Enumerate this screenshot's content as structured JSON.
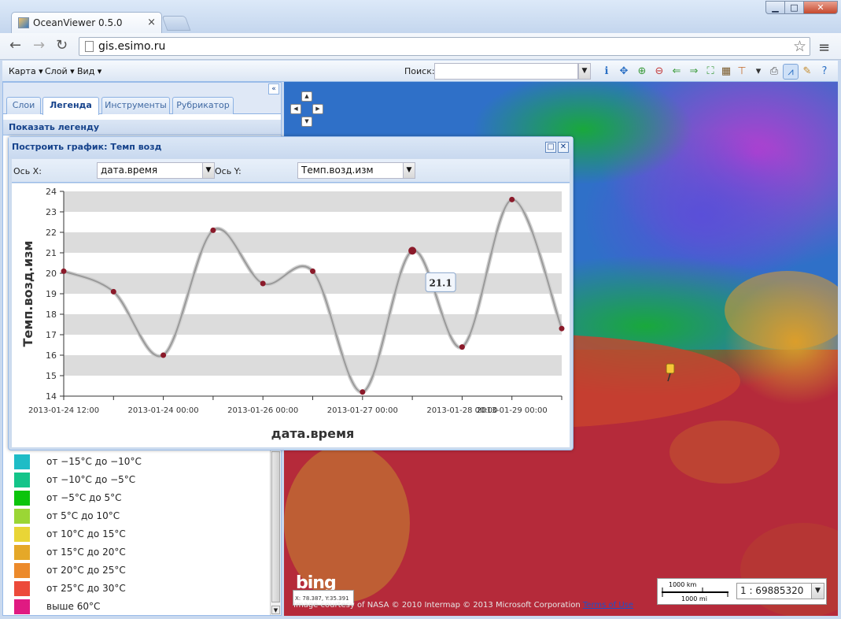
{
  "browser": {
    "tab_title": "OceanViewer 0.5.0",
    "tab_close": "×",
    "url": "gis.esimo.ru",
    "window_buttons": {
      "minimize": "▁",
      "maximize": "□",
      "close": "✕"
    },
    "nav": {
      "back": "←",
      "forward": "→",
      "reload": "↻",
      "star": "☆",
      "menu": "≡"
    }
  },
  "toolbar": {
    "menus": [
      {
        "label": "Карта ▾"
      },
      {
        "label": "Слой ▾"
      },
      {
        "label": "Вид ▾"
      }
    ],
    "search_label": "Поиск:",
    "search_value": "",
    "search_trigger": "▼",
    "icons": [
      {
        "name": "info-icon",
        "glyph": "ℹ",
        "color": "#2a6fc4"
      },
      {
        "name": "pan-icon",
        "glyph": "✥",
        "color": "#2a6fc4"
      },
      {
        "name": "zoom-in-icon",
        "glyph": "⊕",
        "color": "#3a9a3a"
      },
      {
        "name": "zoom-out-icon",
        "glyph": "⊖",
        "color": "#c43a3a"
      },
      {
        "name": "history-back-icon",
        "glyph": "⇐",
        "color": "#3a9a3a"
      },
      {
        "name": "history-forward-icon",
        "glyph": "⇒",
        "color": "#3a9a3a"
      },
      {
        "name": "full-extent-icon",
        "glyph": "⛶",
        "color": "#3a9a3a"
      },
      {
        "name": "table-icon",
        "glyph": "▦",
        "color": "#7a5a2a"
      },
      {
        "name": "measure-icon",
        "glyph": "⊤",
        "color": "#c46a2a"
      },
      {
        "name": "dropdown-icon",
        "glyph": "▾",
        "color": "#333"
      },
      {
        "name": "print-icon",
        "glyph": "⎙",
        "color": "#555"
      },
      {
        "name": "chart-icon",
        "glyph": "⩘",
        "color": "#2a6fc4"
      },
      {
        "name": "edit-icon",
        "glyph": "✎",
        "color": "#c48a2a"
      },
      {
        "name": "help-icon",
        "glyph": "?",
        "color": "#2a6fc4"
      }
    ]
  },
  "left_panel": {
    "collapse": "«",
    "tabs": [
      {
        "label": "Слои",
        "active": false
      },
      {
        "label": "Легенда",
        "active": true
      },
      {
        "label": "Инструменты",
        "active": false
      },
      {
        "label": "Рубрикатор",
        "active": false
      }
    ],
    "legend_header": "Показать легенду",
    "legend": [
      {
        "color": "#1fbcc6",
        "label": "от −15°С до −10°С"
      },
      {
        "color": "#14c489",
        "label": "от −10°С до −5°С"
      },
      {
        "color": "#0bc40b",
        "label": "от −5°С до 5°С"
      },
      {
        "color": "#9bd635",
        "label": "от 5°С до 10°С"
      },
      {
        "color": "#e9d536",
        "label": "от 10°С до 15°С"
      },
      {
        "color": "#e5a828",
        "label": "от 15°С до 20°С"
      },
      {
        "color": "#ec8a2b",
        "label": "от 20°С до 25°С"
      },
      {
        "color": "#ec4a3a",
        "label": "от 25°С до 30°С"
      },
      {
        "color": "#e01a82",
        "label": "выше 60°С"
      }
    ],
    "scroll_down": "▼"
  },
  "map": {
    "pan": {
      "up": "▲",
      "down": "▼",
      "left": "◀",
      "right": "▶"
    },
    "bing_logo": "bing",
    "coords": "X: 78.387, Y:35.391",
    "attribution": "Image courtesy of NASA © 2010 Intermap © 2013 Microsoft Corporation",
    "terms": "Terms of Use",
    "scale_km": "1000 km",
    "scale_mi": "1000 mi",
    "zoom": "1 : 69885320",
    "zoom_trigger": "▼"
  },
  "chart_window": {
    "title": "Построить график: Темп возд",
    "restore": "□",
    "close": "✕",
    "x_axis_label": "Ось X:",
    "x_axis_value": "дата.время",
    "y_axis_label": "Ось Y:",
    "y_axis_value": "Темп.возд.изм",
    "trigger": "▼"
  },
  "chart_data": {
    "type": "line",
    "xlabel": "дата.время",
    "ylabel": "Темп.возд.изм",
    "ylim": [
      14,
      24
    ],
    "yticks": [
      14,
      15,
      16,
      17,
      18,
      19,
      20,
      21,
      22,
      23,
      24
    ],
    "xtick_labels": [
      "2013-01-24 12:00",
      "2013-01-24 00:00",
      "2013-01-26 00:00",
      "2013-01-27 00:00",
      "2013-01-28 00:00",
      "2013-01-29 00:00"
    ],
    "values": [
      20.1,
      19.1,
      16.0,
      22.1,
      19.5,
      20.1,
      14.2,
      21.1,
      16.4,
      23.6,
      17.3
    ],
    "highlight_index": 7,
    "tooltip": "21.1",
    "colors": {
      "line": "#9a9a9a",
      "marker": "#8b1a2a",
      "band": "#dcdcdc"
    }
  }
}
